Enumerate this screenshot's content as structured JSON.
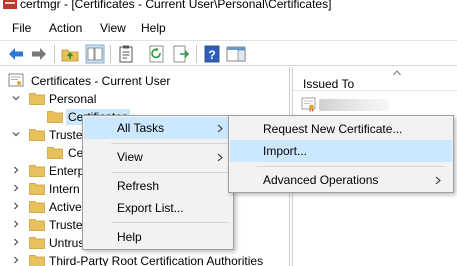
{
  "window": {
    "title": "certmgr - [Certificates - Current User\\Personal\\Certificates]"
  },
  "menu": [
    "File",
    "Action",
    "View",
    "Help"
  ],
  "toolbar": {
    "buttons": [
      "back-icon",
      "forward-icon",
      "up-folder-icon",
      "show-hide-tree-icon",
      "properties-icon",
      "refresh-icon",
      "export-list-icon",
      "help-icon",
      "show-action-pane-icon"
    ]
  },
  "tree": {
    "root": "Certificates - Current User",
    "items": [
      {
        "label": "Personal",
        "expanded": true
      },
      {
        "label": "Certificates",
        "selected": true
      },
      {
        "label": "Truste",
        "expanded": true
      },
      {
        "label": "Ce"
      },
      {
        "label": "Enterp"
      },
      {
        "label": "Intern"
      },
      {
        "label": "Active"
      },
      {
        "label": "Truste"
      },
      {
        "label": "Untrus"
      },
      {
        "label": "Third-Party Root Certification Authorities"
      }
    ]
  },
  "list": {
    "column": "Issued To"
  },
  "context_menu": {
    "items": [
      {
        "label": "All Tasks",
        "submenu": true,
        "highlighted": true
      },
      {
        "label": "View",
        "submenu": true
      },
      {
        "label": "Refresh"
      },
      {
        "label": "Export List..."
      },
      {
        "label": "Help"
      }
    ]
  },
  "submenu": {
    "items": [
      {
        "label": "Request New Certificate..."
      },
      {
        "label": "Import...",
        "highlighted": true
      },
      {
        "label": "Advanced Operations",
        "submenu": true
      }
    ]
  },
  "colors": {
    "highlight": "#cce8ff",
    "menu_bg": "#f2f2f2",
    "folder": "#e8c15a"
  }
}
